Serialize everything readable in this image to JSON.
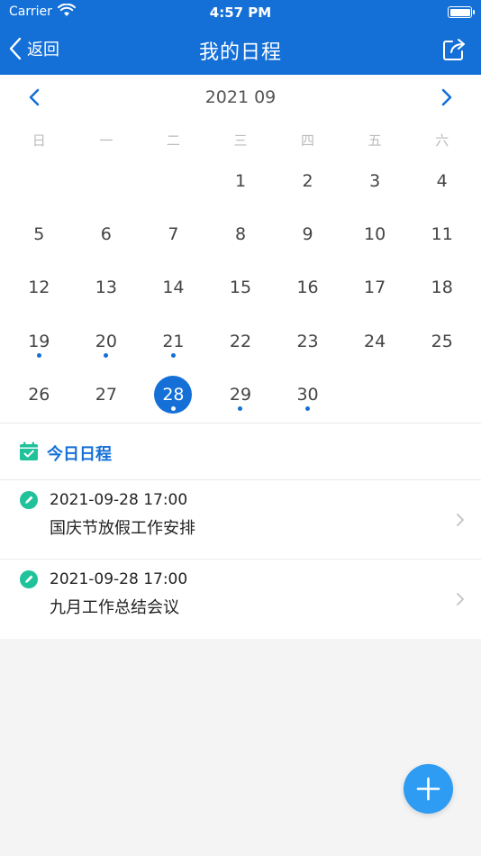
{
  "status_bar": {
    "carrier": "Carrier",
    "time": "4:57 PM"
  },
  "nav": {
    "back_label": "返回",
    "title": "我的日程"
  },
  "calendar": {
    "month_label": "2021 09",
    "weekdays": [
      "日",
      "一",
      "二",
      "三",
      "四",
      "五",
      "六"
    ],
    "leading_blanks": 3,
    "days": [
      {
        "n": "1"
      },
      {
        "n": "2"
      },
      {
        "n": "3"
      },
      {
        "n": "4"
      },
      {
        "n": "5"
      },
      {
        "n": "6"
      },
      {
        "n": "7"
      },
      {
        "n": "8"
      },
      {
        "n": "9"
      },
      {
        "n": "10"
      },
      {
        "n": "11"
      },
      {
        "n": "12"
      },
      {
        "n": "13"
      },
      {
        "n": "14"
      },
      {
        "n": "15"
      },
      {
        "n": "16"
      },
      {
        "n": "17"
      },
      {
        "n": "18"
      },
      {
        "n": "19",
        "dot": true
      },
      {
        "n": "20",
        "dot": true
      },
      {
        "n": "21",
        "dot": true
      },
      {
        "n": "22"
      },
      {
        "n": "23"
      },
      {
        "n": "24"
      },
      {
        "n": "25"
      },
      {
        "n": "26"
      },
      {
        "n": "27"
      },
      {
        "n": "28",
        "dot": true,
        "selected": true
      },
      {
        "n": "29",
        "dot": true
      },
      {
        "n": "30",
        "dot": true
      }
    ]
  },
  "section": {
    "title": "今日日程"
  },
  "schedule": [
    {
      "time": "2021-09-28 17:00",
      "title": "国庆节放假工作安排"
    },
    {
      "time": "2021-09-28 17:00",
      "title": "九月工作总结会议"
    }
  ],
  "colors": {
    "primary": "#1470d7",
    "accent_green": "#1fc29a",
    "fab": "#2e9cf2"
  }
}
